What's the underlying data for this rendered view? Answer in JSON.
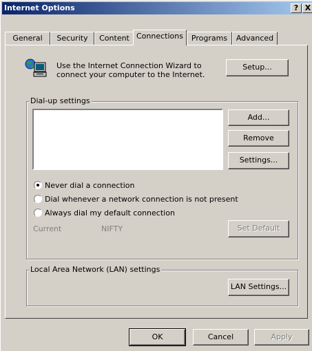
{
  "window": {
    "title": "Internet Options",
    "help_glyph": "?",
    "close_glyph": "X"
  },
  "tabs": [
    {
      "label": "General"
    },
    {
      "label": "Security"
    },
    {
      "label": "Content"
    },
    {
      "label": "Connections",
      "active": true
    },
    {
      "label": "Programs"
    },
    {
      "label": "Advanced"
    }
  ],
  "wizard": {
    "line1": "Use the Internet Connection Wizard to",
    "line2": "connect your computer to the Internet.",
    "setup_label": "Setup..."
  },
  "dialup": {
    "group_label": "Dial-up settings",
    "add_label": "Add...",
    "remove_label": "Remove",
    "settings_label": "Settings...",
    "options": [
      {
        "label": "Never dial a connection",
        "selected": true
      },
      {
        "label": "Dial whenever a network connection is not present",
        "selected": false
      },
      {
        "label": "Always dial my default connection",
        "selected": false
      }
    ],
    "current_label": "Current",
    "current_value": "NIFTY",
    "set_default_label": "Set Default"
  },
  "lan": {
    "group_label": "Local Area Network (LAN) settings",
    "lan_settings_label": "LAN Settings..."
  },
  "footer": {
    "ok_label": "OK",
    "cancel_label": "Cancel",
    "apply_label": "Apply"
  }
}
